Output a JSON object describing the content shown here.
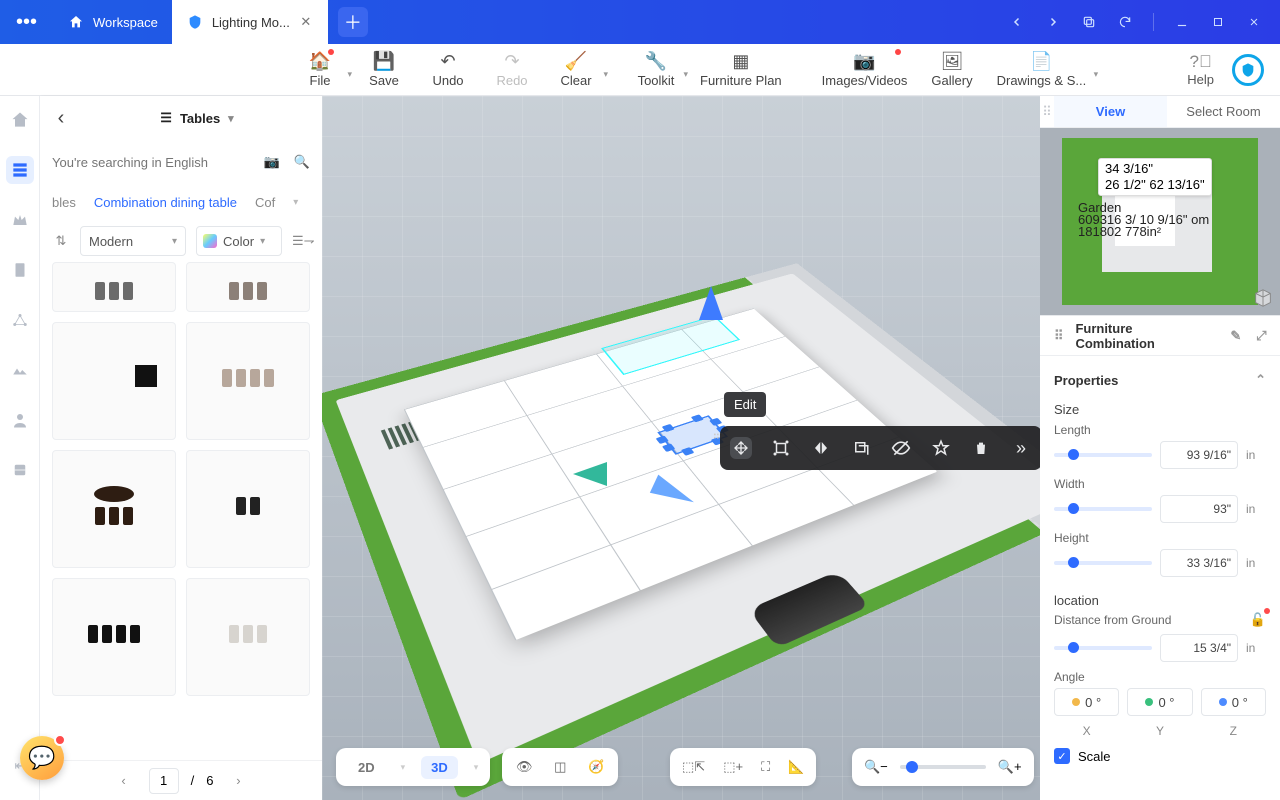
{
  "titlebar": {
    "workspace": "Workspace",
    "active_tab": "Lighting Mo..."
  },
  "toolbar": {
    "file": "File",
    "save": "Save",
    "undo": "Undo",
    "redo": "Redo",
    "clear": "Clear",
    "toolkit": "Toolkit",
    "furniture_plan": "Furniture Plan",
    "images_videos": "Images/Videos",
    "gallery": "Gallery",
    "drawings": "Drawings & S...",
    "help": "Help"
  },
  "catalog": {
    "title": "Tables",
    "search_placeholder": "You're searching in English",
    "tabs": {
      "prev": "bles",
      "active": "Combination dining table",
      "next": "Cof"
    },
    "style_filter": "Modern",
    "color_filter": "Color",
    "page_current": "1",
    "page_total": "6"
  },
  "ctx": {
    "edit": "Edit"
  },
  "view_switch": {
    "two_d": "2D",
    "three_d": "3D"
  },
  "minimap": {
    "view_tab": "View",
    "select_tab": "Select Room",
    "dim1": "34 3/16\"",
    "dim2a": "26 1/2\"",
    "dim2b": "62 13/16\"",
    "garden": "Garden",
    "l3a": "609316 3/",
    "l3b": "10 9/16\"",
    "l3c": "om",
    "l4": "181802 778in²"
  },
  "props": {
    "header": "Furniture Combination",
    "properties": "Properties",
    "size": "Size",
    "length": "Length",
    "length_val": "93 9/16\"",
    "width": "Width",
    "width_val": "93\"",
    "height": "Height",
    "height_val": "33 3/16\"",
    "unit": "in",
    "location": "location",
    "dfg": "Distance from Ground",
    "dfg_val": "15 3/4\"",
    "angle": "Angle",
    "angle_val": "0 °",
    "x": "X",
    "y": "Y",
    "z": "Z",
    "scale": "Scale"
  }
}
